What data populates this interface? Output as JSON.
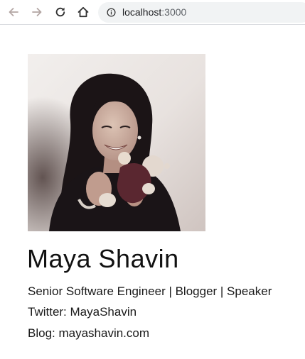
{
  "browser": {
    "url_host": "localhost",
    "url_port": ":3000",
    "icons": {
      "back": "arrow-left-icon",
      "forward": "arrow-right-icon",
      "reload": "reload-icon",
      "home": "home-icon",
      "site_info": "info-circle-icon"
    }
  },
  "profile": {
    "name": "Maya Shavin",
    "title": "Senior Software Engineer | Blogger | Speaker",
    "twitter": "Twitter: MayaShavin",
    "blog": "Blog: mayashavin.com"
  },
  "colors": {
    "toolbar_icon_active": "#5f6368",
    "toolbar_icon_disabled": "#c4c7c5",
    "omnibox_bg": "#f1f3f4",
    "text": "#1a1a1a"
  }
}
